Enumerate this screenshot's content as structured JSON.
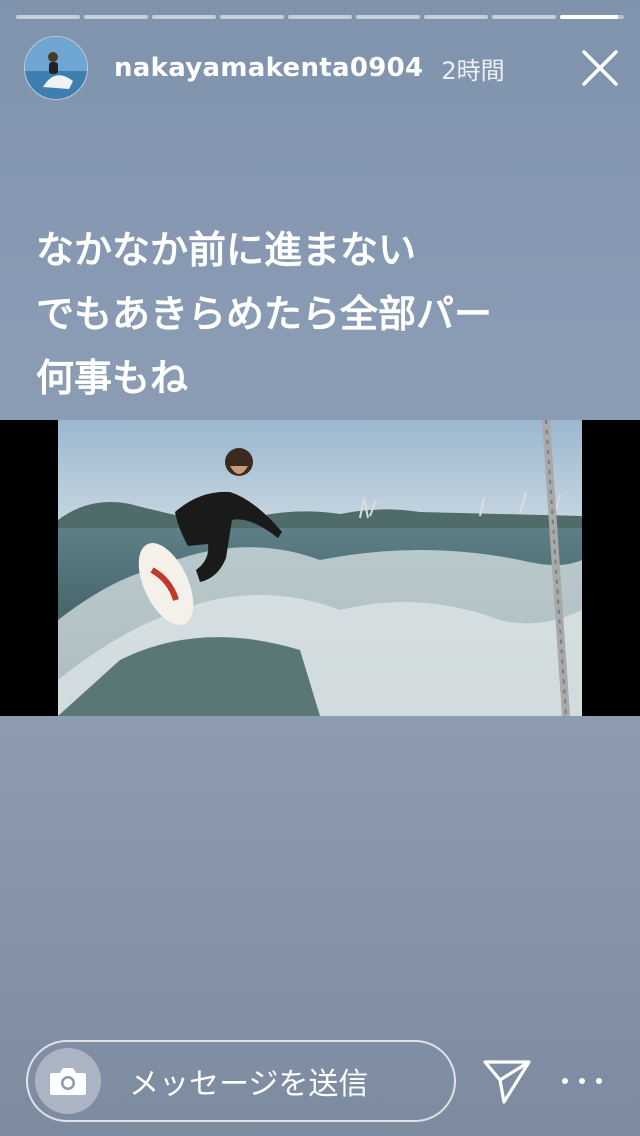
{
  "story": {
    "segments_total": 9,
    "active_segment": 9,
    "active_progress": 0.9
  },
  "header": {
    "username": "nakayamakenta0904",
    "time": "2時間",
    "avatar_icon": "avatar-photo",
    "close_icon": "close-icon"
  },
  "caption": {
    "lines": [
      "なかなか前に進まない",
      "でもあきらめたら全部パー",
      "何事もね"
    ]
  },
  "media": {
    "description_icon": "surfing-photo",
    "letterbox_color": "#000000"
  },
  "reply": {
    "placeholder": "メッセージを送信",
    "camera_icon": "camera-icon",
    "send_icon": "send-icon",
    "more_icon": "more-icon"
  },
  "colors": {
    "background_top": "#7f93ad",
    "background_bottom": "#7d8ba0",
    "text": "#ffffff"
  }
}
